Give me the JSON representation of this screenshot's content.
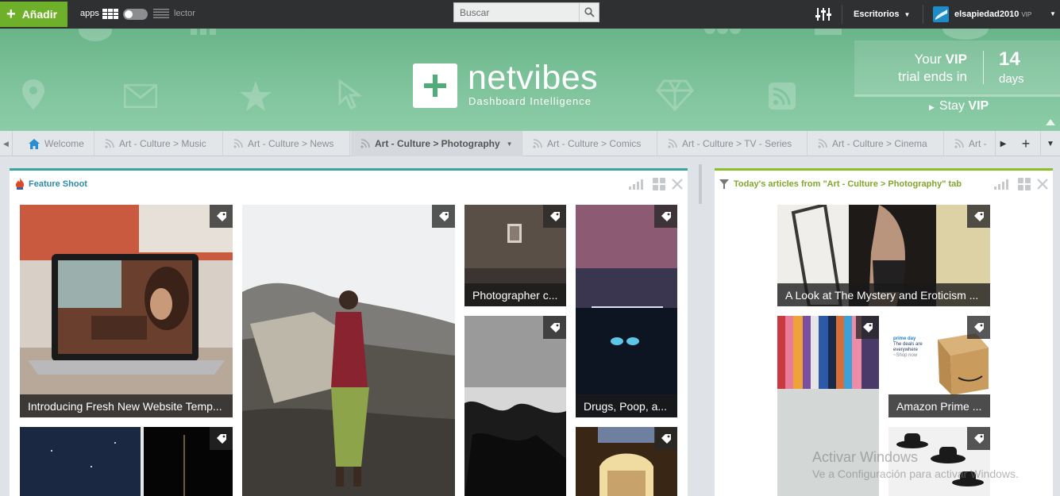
{
  "topbar": {
    "add_label": "Añadir",
    "apps_label": "apps",
    "lector_label": "lector",
    "search_placeholder": "Buscar",
    "desktops_label": "Escritorios",
    "username": "elsapiedad2010",
    "user_badge": "VIP"
  },
  "banner": {
    "logo_text": "netvibes",
    "tagline": "Dashboard Intelligence",
    "vip_line1_pre": "Your ",
    "vip_line1_bold": "VIP",
    "vip_line2": "trial ends in",
    "days_number": "14",
    "days_label": "days",
    "stay_pre": "Stay ",
    "stay_bold": "VIP"
  },
  "tabs": [
    {
      "label": "Welcome",
      "icon": "home-icon"
    },
    {
      "label": "Art - Culture > Music",
      "icon": "rss-icon"
    },
    {
      "label": "Art - Culture > News",
      "icon": "rss-icon"
    },
    {
      "label": "Art - Culture > Photography",
      "icon": "rss-icon",
      "active": true
    },
    {
      "label": "Art - Culture > Comics",
      "icon": "rss-icon"
    },
    {
      "label": "Art - Culture > TV - Series",
      "icon": "rss-icon"
    },
    {
      "label": "Art - Culture > Cinema",
      "icon": "rss-icon"
    },
    {
      "label": "Art -",
      "icon": "rss-icon"
    }
  ],
  "widget_left": {
    "title": "Feature Shoot",
    "accent": "#3aa3a5",
    "captions": {
      "laptop": "Introducing Fresh New Website Temp...",
      "photographer": "Photographer c...",
      "drugs": "Drugs, Poop, a..."
    }
  },
  "widget_right": {
    "title": "Today's articles from \"Art - Culture > Photography\" tab",
    "accent": "#8cbd2a",
    "captions": {
      "mystery": "A Look at The Mystery and Eroticism ...",
      "amazon": "Amazon Prime ..."
    },
    "amazon_art": {
      "brand": "prime day",
      "headline": "The deals are everywhere",
      "sub": "~Shop now"
    }
  },
  "watermark": {
    "line1": "Activar Windows",
    "line2": "Ve a Configuración para activar Windows."
  },
  "colors": {
    "topbar": "#2f3032",
    "add_button": "#6fb02b",
    "banner": "#7ec39b"
  }
}
